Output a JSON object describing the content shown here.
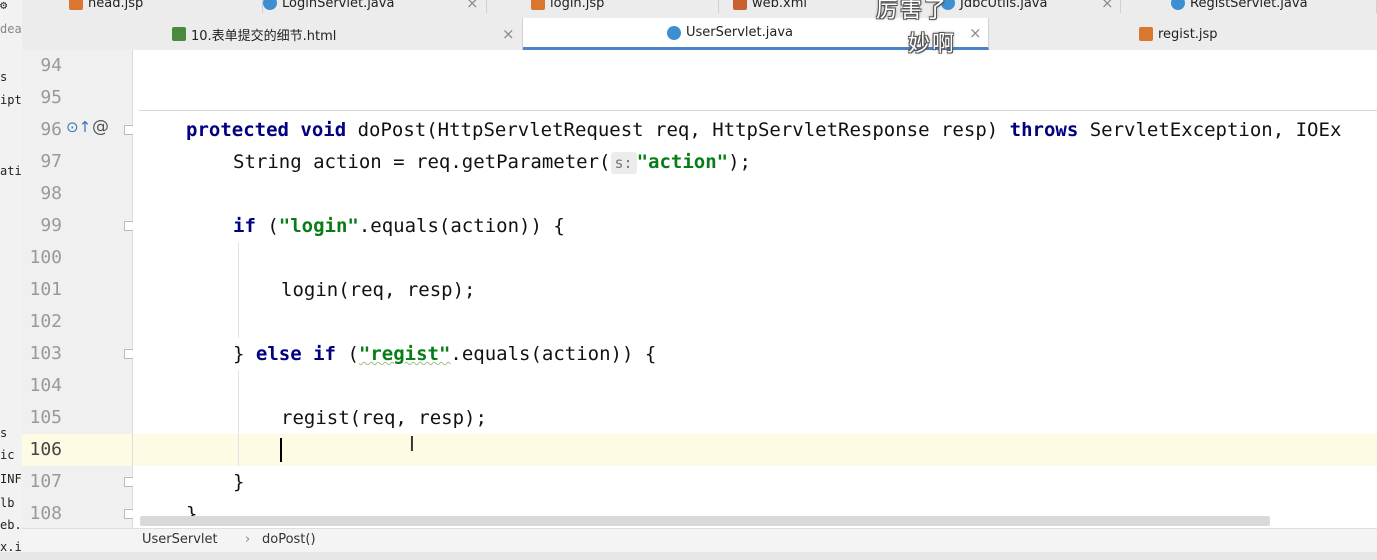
{
  "left_panel": {
    "fragments": [
      "⚙",
      "dea",
      "s",
      "ipt",
      "ati",
      "s",
      "ic",
      "INF",
      "lb",
      "eb.",
      "x.i"
    ]
  },
  "top_tabs": [
    {
      "label": "head.jsp",
      "icon": "jsp-file-icon"
    },
    {
      "label": "LoginServlet.java",
      "icon": "java-class-icon"
    },
    {
      "label": "login.jsp",
      "icon": "jsp-file-icon"
    },
    {
      "label": "web.xml",
      "icon": "xml-file-icon"
    },
    {
      "label": "JdbcUtils.java",
      "icon": "java-class-icon"
    },
    {
      "label": "RegistServlet.java",
      "icon": "java-class-icon"
    }
  ],
  "second_tabs": [
    {
      "label": "10.表单提交的细节.html",
      "icon": "html-file-icon",
      "active": false
    },
    {
      "label": "UserServlet.java",
      "icon": "java-class-icon",
      "active": true
    },
    {
      "label": "regist.jsp",
      "icon": "jsp-file-icon",
      "active": false
    }
  ],
  "tab_close_glyph": "×",
  "overlay": {
    "line1": "厉害了",
    "line2": "妙啊"
  },
  "line_numbers": [
    "94",
    "95",
    "96",
    "97",
    "98",
    "99",
    "100",
    "101",
    "102",
    "103",
    "104",
    "105",
    "106",
    "107",
    "108"
  ],
  "current_line": "106",
  "code": {
    "l96": {
      "kw1": "protected",
      "kw2": "void",
      "sig1": " doPost(HttpServletRequest req, HttpServletResponse resp) ",
      "kw3": "throws",
      "sig2": " ServletException, IOEx"
    },
    "l97": {
      "pre": "String action = req.getParameter(",
      "hint": "s:",
      "str": "\"action\"",
      "post": ");"
    },
    "l99": {
      "kw": "if",
      "pre": " (",
      "str": "\"login\"",
      "post": ".equals(action)) {"
    },
    "l101": "login(req, resp);",
    "l103": {
      "pre": "} ",
      "kw1": "else",
      "kw2": "if",
      "mid": " (",
      "str": "\"regist\"",
      "post": ".equals(action)) {"
    },
    "l105": "regist(req, resp);",
    "l107": "}",
    "l108": "}"
  },
  "gutter_marks": {
    "override": "⊙↑",
    "annotation": "@"
  },
  "breadcrumb": {
    "class": "UserServlet",
    "sep": "›",
    "method": "doPost()"
  },
  "colors": {
    "keyword": "#000080",
    "string": "#067d17",
    "current_line": "#fdfbe4",
    "active_tab_underline": "#4a83c9"
  }
}
